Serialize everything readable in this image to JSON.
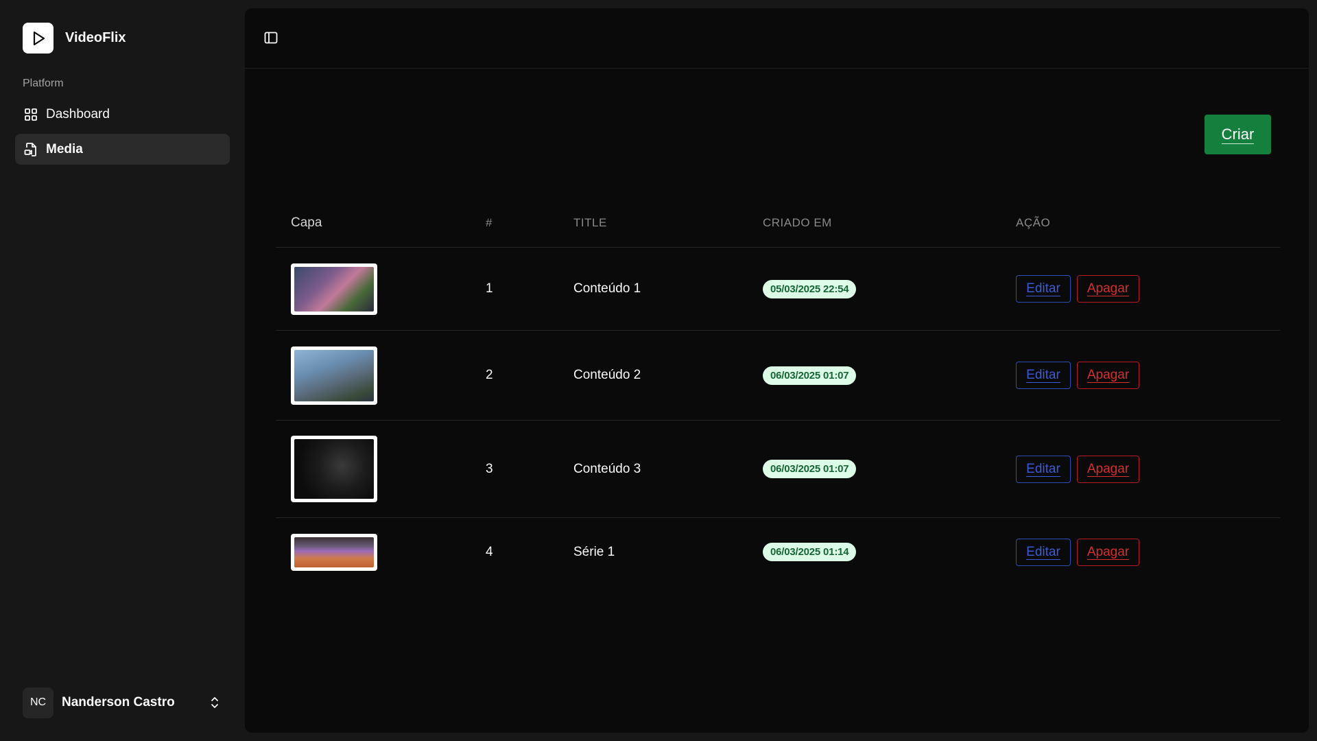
{
  "app": {
    "name": "VideoFlix"
  },
  "sidebar": {
    "section_label": "Platform",
    "items": [
      {
        "label": "Dashboard",
        "icon": "grid-icon",
        "active": false
      },
      {
        "label": "Media",
        "icon": "media-file-icon",
        "active": true
      }
    ]
  },
  "user": {
    "initials": "NC",
    "name": "Nanderson Castro"
  },
  "toolbar": {
    "create_label": "Criar"
  },
  "table": {
    "columns": [
      "Capa",
      "#",
      "TITLE",
      "CRIADO EM",
      "AÇÃO"
    ],
    "rows": [
      {
        "id": "1",
        "title": "Conteúdo 1",
        "created_at": "05/03/2025 22:54",
        "edit_label": "Editar",
        "delete_label": "Apagar"
      },
      {
        "id": "2",
        "title": "Conteúdo 2",
        "created_at": "06/03/2025 01:07",
        "edit_label": "Editar",
        "delete_label": "Apagar"
      },
      {
        "id": "3",
        "title": "Conteúdo 3",
        "created_at": "06/03/2025 01:07",
        "edit_label": "Editar",
        "delete_label": "Apagar"
      },
      {
        "id": "4",
        "title": "Série 1",
        "created_at": "06/03/2025 01:14",
        "edit_label": "Editar",
        "delete_label": "Apagar"
      }
    ]
  },
  "colors": {
    "accent_green": "#15803d",
    "badge_bg": "#dcfce7",
    "badge_text": "#166534",
    "edit_blue": "#3b5bd6",
    "delete_red": "#d32f2f"
  }
}
